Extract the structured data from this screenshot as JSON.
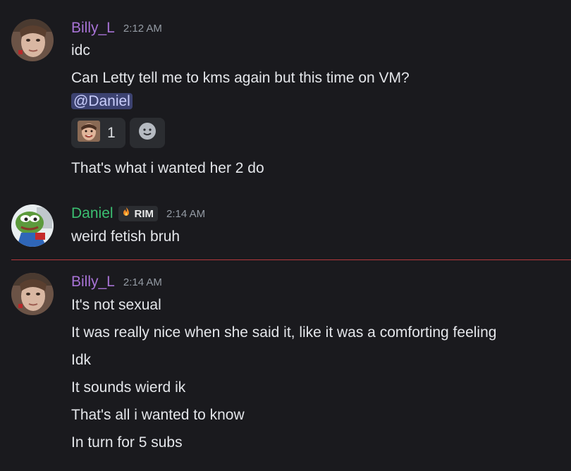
{
  "messages": [
    {
      "author": "Billy_L",
      "author_color": "#a873d6",
      "timestamp": "2:12 AM",
      "lines": [
        "idc",
        "Can Letty tell me to kms again but this time on VM?"
      ],
      "mention": "@Daniel",
      "reactions": [
        {
          "icon": "face-emoji-icon",
          "count": "1"
        }
      ],
      "add_reaction_icon": "add-reaction-icon",
      "after_lines": [
        "That's what i wanted her 2 do"
      ]
    },
    {
      "author": "Daniel",
      "author_color": "#3bbf71",
      "tag": "RIM",
      "timestamp": "2:14 AM",
      "lines": [
        "weird fetish bruh"
      ]
    },
    {
      "author": "Billy_L",
      "author_color": "#a873d6",
      "timestamp": "2:14 AM",
      "lines": [
        "It's not sexual",
        "It was really nice when she said it, like it was a comforting feeling",
        "Idk",
        "It sounds wierd ik",
        "That's all i wanted to know",
        "In turn for 5 subs"
      ]
    }
  ],
  "colors": {
    "background": "#1a1a1e",
    "new_messages_divider": "#b5393d",
    "mention_bg": "#3c4270"
  }
}
